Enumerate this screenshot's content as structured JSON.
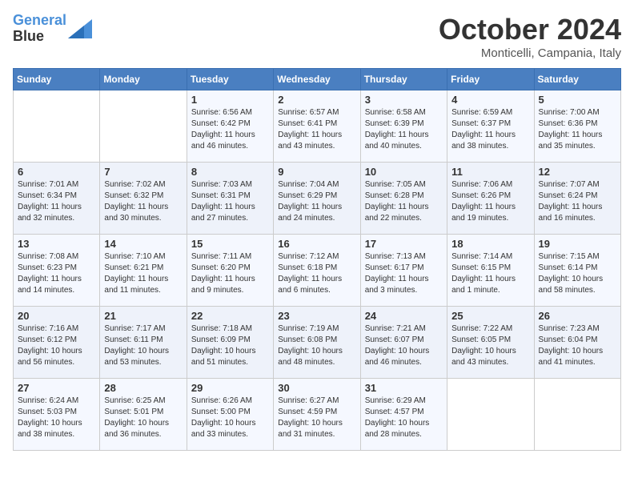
{
  "logo": {
    "line1": "General",
    "line2": "Blue"
  },
  "title": "October 2024",
  "location": "Monticelli, Campania, Italy",
  "weekdays": [
    "Sunday",
    "Monday",
    "Tuesday",
    "Wednesday",
    "Thursday",
    "Friday",
    "Saturday"
  ],
  "weeks": [
    [
      {
        "day": "",
        "info": ""
      },
      {
        "day": "",
        "info": ""
      },
      {
        "day": "1",
        "info": "Sunrise: 6:56 AM\nSunset: 6:42 PM\nDaylight: 11 hours and 46 minutes."
      },
      {
        "day": "2",
        "info": "Sunrise: 6:57 AM\nSunset: 6:41 PM\nDaylight: 11 hours and 43 minutes."
      },
      {
        "day": "3",
        "info": "Sunrise: 6:58 AM\nSunset: 6:39 PM\nDaylight: 11 hours and 40 minutes."
      },
      {
        "day": "4",
        "info": "Sunrise: 6:59 AM\nSunset: 6:37 PM\nDaylight: 11 hours and 38 minutes."
      },
      {
        "day": "5",
        "info": "Sunrise: 7:00 AM\nSunset: 6:36 PM\nDaylight: 11 hours and 35 minutes."
      }
    ],
    [
      {
        "day": "6",
        "info": "Sunrise: 7:01 AM\nSunset: 6:34 PM\nDaylight: 11 hours and 32 minutes."
      },
      {
        "day": "7",
        "info": "Sunrise: 7:02 AM\nSunset: 6:32 PM\nDaylight: 11 hours and 30 minutes."
      },
      {
        "day": "8",
        "info": "Sunrise: 7:03 AM\nSunset: 6:31 PM\nDaylight: 11 hours and 27 minutes."
      },
      {
        "day": "9",
        "info": "Sunrise: 7:04 AM\nSunset: 6:29 PM\nDaylight: 11 hours and 24 minutes."
      },
      {
        "day": "10",
        "info": "Sunrise: 7:05 AM\nSunset: 6:28 PM\nDaylight: 11 hours and 22 minutes."
      },
      {
        "day": "11",
        "info": "Sunrise: 7:06 AM\nSunset: 6:26 PM\nDaylight: 11 hours and 19 minutes."
      },
      {
        "day": "12",
        "info": "Sunrise: 7:07 AM\nSunset: 6:24 PM\nDaylight: 11 hours and 16 minutes."
      }
    ],
    [
      {
        "day": "13",
        "info": "Sunrise: 7:08 AM\nSunset: 6:23 PM\nDaylight: 11 hours and 14 minutes."
      },
      {
        "day": "14",
        "info": "Sunrise: 7:10 AM\nSunset: 6:21 PM\nDaylight: 11 hours and 11 minutes."
      },
      {
        "day": "15",
        "info": "Sunrise: 7:11 AM\nSunset: 6:20 PM\nDaylight: 11 hours and 9 minutes."
      },
      {
        "day": "16",
        "info": "Sunrise: 7:12 AM\nSunset: 6:18 PM\nDaylight: 11 hours and 6 minutes."
      },
      {
        "day": "17",
        "info": "Sunrise: 7:13 AM\nSunset: 6:17 PM\nDaylight: 11 hours and 3 minutes."
      },
      {
        "day": "18",
        "info": "Sunrise: 7:14 AM\nSunset: 6:15 PM\nDaylight: 11 hours and 1 minute."
      },
      {
        "day": "19",
        "info": "Sunrise: 7:15 AM\nSunset: 6:14 PM\nDaylight: 10 hours and 58 minutes."
      }
    ],
    [
      {
        "day": "20",
        "info": "Sunrise: 7:16 AM\nSunset: 6:12 PM\nDaylight: 10 hours and 56 minutes."
      },
      {
        "day": "21",
        "info": "Sunrise: 7:17 AM\nSunset: 6:11 PM\nDaylight: 10 hours and 53 minutes."
      },
      {
        "day": "22",
        "info": "Sunrise: 7:18 AM\nSunset: 6:09 PM\nDaylight: 10 hours and 51 minutes."
      },
      {
        "day": "23",
        "info": "Sunrise: 7:19 AM\nSunset: 6:08 PM\nDaylight: 10 hours and 48 minutes."
      },
      {
        "day": "24",
        "info": "Sunrise: 7:21 AM\nSunset: 6:07 PM\nDaylight: 10 hours and 46 minutes."
      },
      {
        "day": "25",
        "info": "Sunrise: 7:22 AM\nSunset: 6:05 PM\nDaylight: 10 hours and 43 minutes."
      },
      {
        "day": "26",
        "info": "Sunrise: 7:23 AM\nSunset: 6:04 PM\nDaylight: 10 hours and 41 minutes."
      }
    ],
    [
      {
        "day": "27",
        "info": "Sunrise: 6:24 AM\nSunset: 5:03 PM\nDaylight: 10 hours and 38 minutes."
      },
      {
        "day": "28",
        "info": "Sunrise: 6:25 AM\nSunset: 5:01 PM\nDaylight: 10 hours and 36 minutes."
      },
      {
        "day": "29",
        "info": "Sunrise: 6:26 AM\nSunset: 5:00 PM\nDaylight: 10 hours and 33 minutes."
      },
      {
        "day": "30",
        "info": "Sunrise: 6:27 AM\nSunset: 4:59 PM\nDaylight: 10 hours and 31 minutes."
      },
      {
        "day": "31",
        "info": "Sunrise: 6:29 AM\nSunset: 4:57 PM\nDaylight: 10 hours and 28 minutes."
      },
      {
        "day": "",
        "info": ""
      },
      {
        "day": "",
        "info": ""
      }
    ]
  ]
}
